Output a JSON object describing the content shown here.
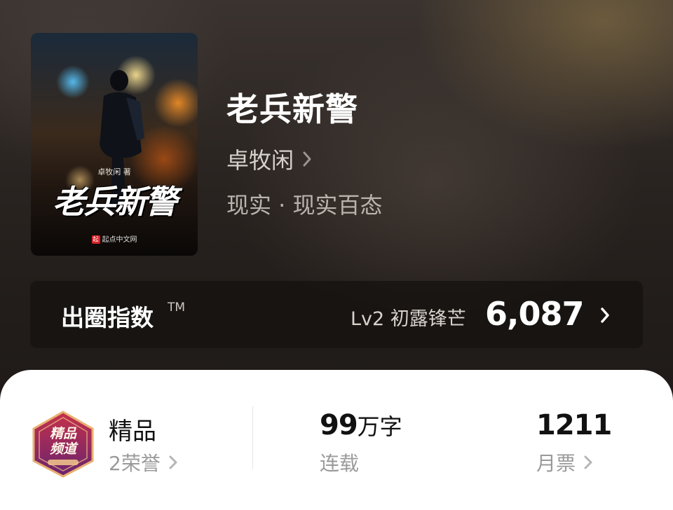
{
  "book": {
    "title": "老兵新警",
    "author": "卓牧闲",
    "genre": "现实 · 现实百态",
    "cover": {
      "author_tag": "卓牧闲 著",
      "title": "老兵新警",
      "publisher": "起点中文网",
      "publisher_logo": "起"
    }
  },
  "index": {
    "label": "出圈指数",
    "tm": "TM",
    "level": "Lv2 初露锋芒",
    "value": "6,087"
  },
  "stats": {
    "quality": {
      "title": "精品",
      "honors": "2荣誉",
      "badge_line1": "精品",
      "badge_line2": "频道"
    },
    "words": {
      "number": "99",
      "unit": "万字",
      "status": "连载"
    },
    "tickets": {
      "number": "1211",
      "label": "月票"
    }
  },
  "colors": {
    "accent_red": "#d8232a",
    "badge_purple": "#7a2a6e"
  },
  "icons": [
    "chevron-right-icon",
    "quality-badge-icon"
  ]
}
